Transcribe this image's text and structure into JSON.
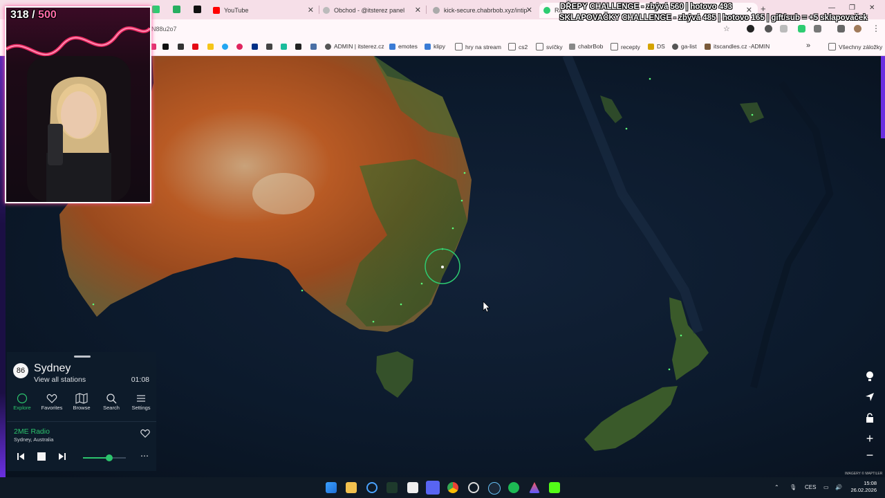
{
  "browser": {
    "tabs": [
      {
        "label": "YouTube",
        "favicon": "youtube-icon"
      },
      {
        "label": "Obchod - @itsterez panel",
        "favicon": "shop-icon"
      },
      {
        "label": "kick-secure.chabrbob.xyz/intip",
        "favicon": "kick-icon"
      },
      {
        "label": "Ra",
        "favicon": "radio-garden-icon"
      }
    ],
    "address_fragment": "N88u2o7",
    "bookmarks": [
      {
        "label": "ADMIN | itsterez.cz"
      },
      {
        "label": "emotes"
      },
      {
        "label": "klipy"
      },
      {
        "label": "hry na stream"
      },
      {
        "label": "cs2"
      },
      {
        "label": "svíčky"
      },
      {
        "label": "chabrBob"
      },
      {
        "label": "recepty"
      },
      {
        "label": "DS"
      },
      {
        "label": "ga-list"
      },
      {
        "label": "itscandles.cz -ADMIN"
      }
    ],
    "all_bookmarks": "Všechny záložky"
  },
  "overlay": {
    "line1": "DŘEPY CHALLENGE - zbývá 560 | hotovo 493",
    "line2": "SKLAPOVAČKY CHALLENGE - zbývá 485 | hotovo 165 | gift/sub = +5 sklapovaček",
    "count_current": "318",
    "count_sep": " / ",
    "count_goal": "500"
  },
  "radio": {
    "station_count": "86",
    "city": "Sydney",
    "view_all": "View all stations",
    "local_time": "01:08",
    "nav": [
      {
        "label": "Explore",
        "icon": "explore-icon",
        "active": true
      },
      {
        "label": "Favorites",
        "icon": "heart-icon",
        "active": false
      },
      {
        "label": "Browse",
        "icon": "map-icon",
        "active": false
      },
      {
        "label": "Search",
        "icon": "search-icon",
        "active": false
      },
      {
        "label": "Settings",
        "icon": "menu-icon",
        "active": false
      }
    ],
    "now_playing": {
      "station": "2ME Radio",
      "location": "Sydney, Australia"
    },
    "volume": 0.62
  },
  "map_credit": "IMAGERY © MAPTILER",
  "taskbar": {
    "language": "CES",
    "time": "15:08",
    "date": "26.02.2026"
  },
  "colors": {
    "accent": "#2ecc71",
    "panel": "#0e1c2b",
    "tabbar": "#f6dfe8"
  }
}
